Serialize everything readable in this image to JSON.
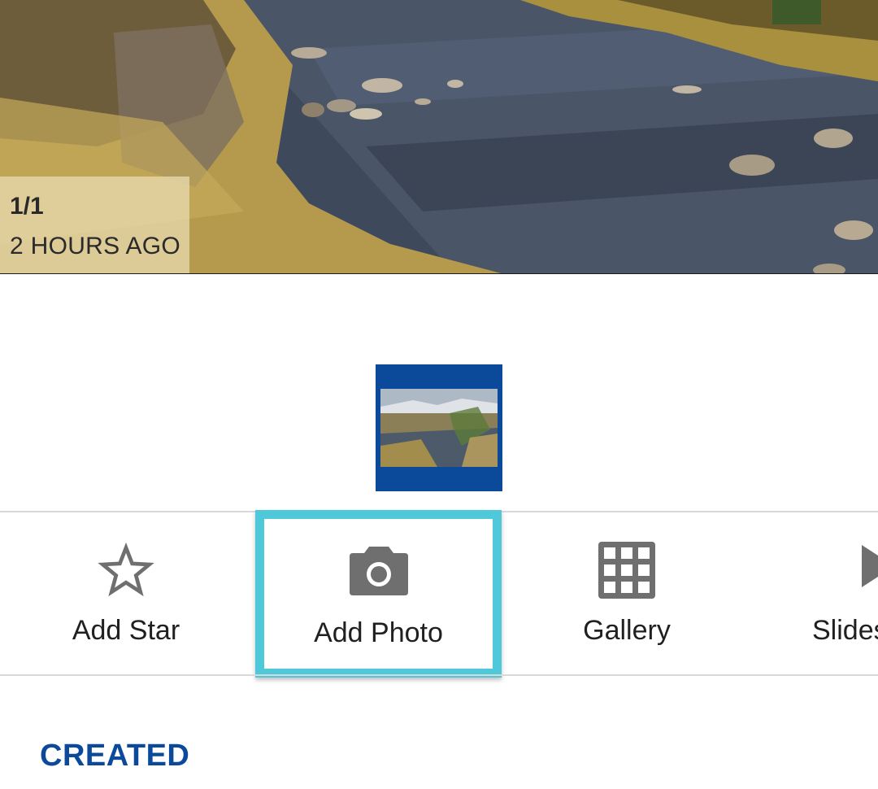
{
  "viewer": {
    "counter": "1/1",
    "timestamp": "2 HOURS AGO"
  },
  "thumbnail": {
    "frame_color": "#0b4a9a"
  },
  "actions": [
    {
      "label": "Add Star",
      "icon": "star-outline-icon"
    },
    {
      "label": "Add Photo",
      "icon": "camera-icon",
      "highlighted": true
    },
    {
      "label": "Gallery",
      "icon": "grid-icon"
    },
    {
      "label": "Slides",
      "icon": "play-icon"
    }
  ],
  "section": {
    "title": "CREATED"
  },
  "colors": {
    "accent_blue": "#0b4a9a",
    "highlight": "#4fc9d9",
    "icon_gray": "#6f6f6f"
  }
}
